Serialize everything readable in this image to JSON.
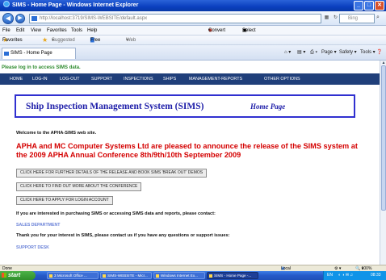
{
  "window": {
    "title": "SIMS - Home Page - Windows Internet Explorer",
    "min": "_",
    "max": "□",
    "close": "✕"
  },
  "address": {
    "url": "http://localhost:3719/SIMS-WEBSITE/default.aspx",
    "search_placeholder": "Bing"
  },
  "menu": {
    "items": [
      "File",
      "Edit",
      "View",
      "Favorites",
      "Tools",
      "Help"
    ],
    "convert": "Convert",
    "select": "Select"
  },
  "favorites": {
    "label": "Favorites",
    "suggested": "Suggested Sites",
    "hotmail": "Free Hotmail",
    "gallery": "Web Slice Gallery"
  },
  "tab": {
    "label": "SIMS - Home Page"
  },
  "commandbar": {
    "page": "Page",
    "safety": "Safety",
    "tools": "Tools"
  },
  "page": {
    "login_msg": "Please log in to access SIMS data.",
    "nav": [
      "HOME",
      "LOG-IN",
      "LOG-OUT",
      "SUPPORT",
      "INSPECTIONS",
      "SHIPS",
      "MANAGEMENT-REPORTS",
      "OTHER OPTIONS"
    ],
    "banner_title": "Ship Inspection Management System (SIMS)",
    "banner_home": "Home Page",
    "welcome": "Welcome to the APHA-SIMS web site.",
    "announce": "APHA and MC Computer Systems Ltd are pleased to announce the release of the SIMS system at the 2009 APHA Annual Conference 8th/9th/10th September 2009",
    "buttons": [
      "CLICK HERE FOR FURTHER DETAILS OF THE RELEASE AND BOOK SIMS 'BREAK OUT' DEMOS",
      "CLICK HERE TO FIND OUT MORE ABOUT THE CONFERENCE",
      "CLICK HERE TO APPLY FOR LOGIN ACCOUNT"
    ],
    "purchase_text": "If you are interested in purchasing SIMS or accessing SIMS data and reports, please contact:",
    "sales_link": "SALES DEPARTMENT",
    "thanks_text": "Thank you for your interest in SIMS, please contact us if you have any questions or support issues:",
    "support_link": "SUPPORT DESK"
  },
  "status": {
    "left": "Done",
    "zone": "Local intranet",
    "zoom": "100%"
  },
  "taskbar": {
    "start": "start",
    "tasks": [
      "3 Microsoft Office ...",
      "SIMS-WEBSITE - Micr...",
      "Windows Internet Ex...",
      "SIMS - Home Page -..."
    ],
    "lang": "EN",
    "clock": "08:33"
  }
}
